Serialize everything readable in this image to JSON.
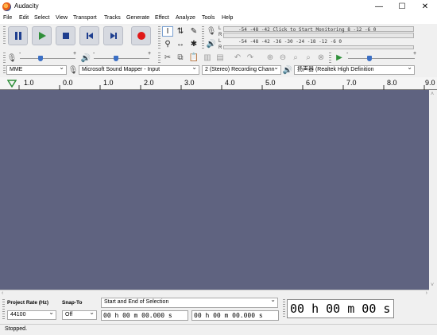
{
  "window": {
    "title": "Audacity",
    "minimize": "—",
    "maximize": "☐",
    "close": "✕"
  },
  "menu": [
    "File",
    "Edit",
    "Select",
    "View",
    "Transport",
    "Tracks",
    "Generate",
    "Effect",
    "Analyze",
    "Tools",
    "Help"
  ],
  "meters": {
    "record_scale": "-54  -48  -42  Click to Start Monitoring  8   -12   -6   0",
    "playback_scale": "-54  -48  -42  -36  -30  -24  -18  -12   -6   0",
    "left_label": "L",
    "right_label": "R",
    "playback_scale_lower": "-54  -48  -42  -36  -30  -24  -18  -12   -6   0"
  },
  "sliders": {
    "minus": "-",
    "plus": "+"
  },
  "devices": {
    "host": "MME",
    "recording_device": "Microsoft Sound Mapper - Input",
    "recording_channels": "2 (Stereo) Recording Chann",
    "playback_device": "扬声器 (Realtek High Definition"
  },
  "timeline": {
    "ticks": [
      "1.0",
      "0.0",
      "1.0",
      "2.0",
      "3.0",
      "4.0",
      "5.0",
      "6.0",
      "7.0",
      "8.0",
      "9.0"
    ]
  },
  "selection_toolbar": {
    "project_rate_label": "Project Rate (Hz)",
    "project_rate_value": "44100",
    "snap_to_label": "Snap-To",
    "snap_to_value": "Off",
    "selection_mode": "Start and End of Selection",
    "start_time": "00 h 00 m 00.000 s",
    "end_time": "00 h 00 m 00.000 s"
  },
  "audio_position": "00 h 00 m 00 s",
  "status": "Stopped.",
  "colors": {
    "track_bg": "#5f6380",
    "record_red": "#e01818",
    "play_green": "#2f8f3a",
    "transport_bg": "#d6d9e0"
  }
}
